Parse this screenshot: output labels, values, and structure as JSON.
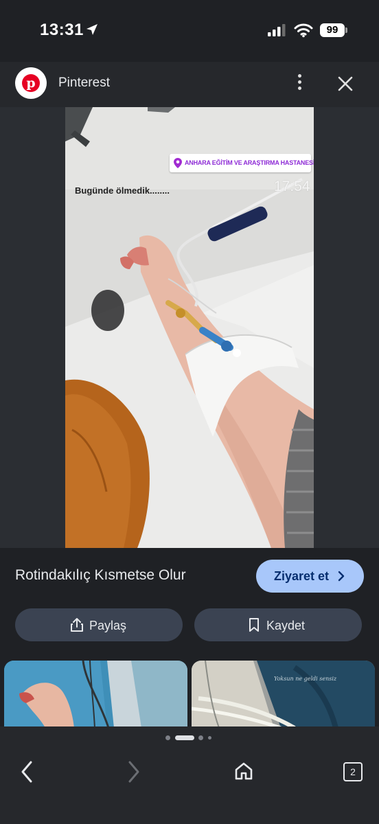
{
  "status_bar": {
    "time": "13:31",
    "battery": "99"
  },
  "header": {
    "site_name": "Pinterest"
  },
  "image": {
    "location_badge": "ANHARA EĞİTİM VE ARAŞTIRMA HASTANESİ",
    "caption": "Bugünde ölmedik........",
    "timestamp": "17:54"
  },
  "info": {
    "title": "Rotindakılıç Kısmetse Olur",
    "visit_label": "Ziyaret et",
    "share_label": "Paylaş",
    "save_label": "Kaydet",
    "thumb2_caption": "Yoksun ne geldi sensiz"
  },
  "bottom_nav": {
    "tab_count": "2"
  },
  "colors": {
    "accent": "#a8c7fa",
    "pill": "#3b4352",
    "brand": "#e60023"
  }
}
